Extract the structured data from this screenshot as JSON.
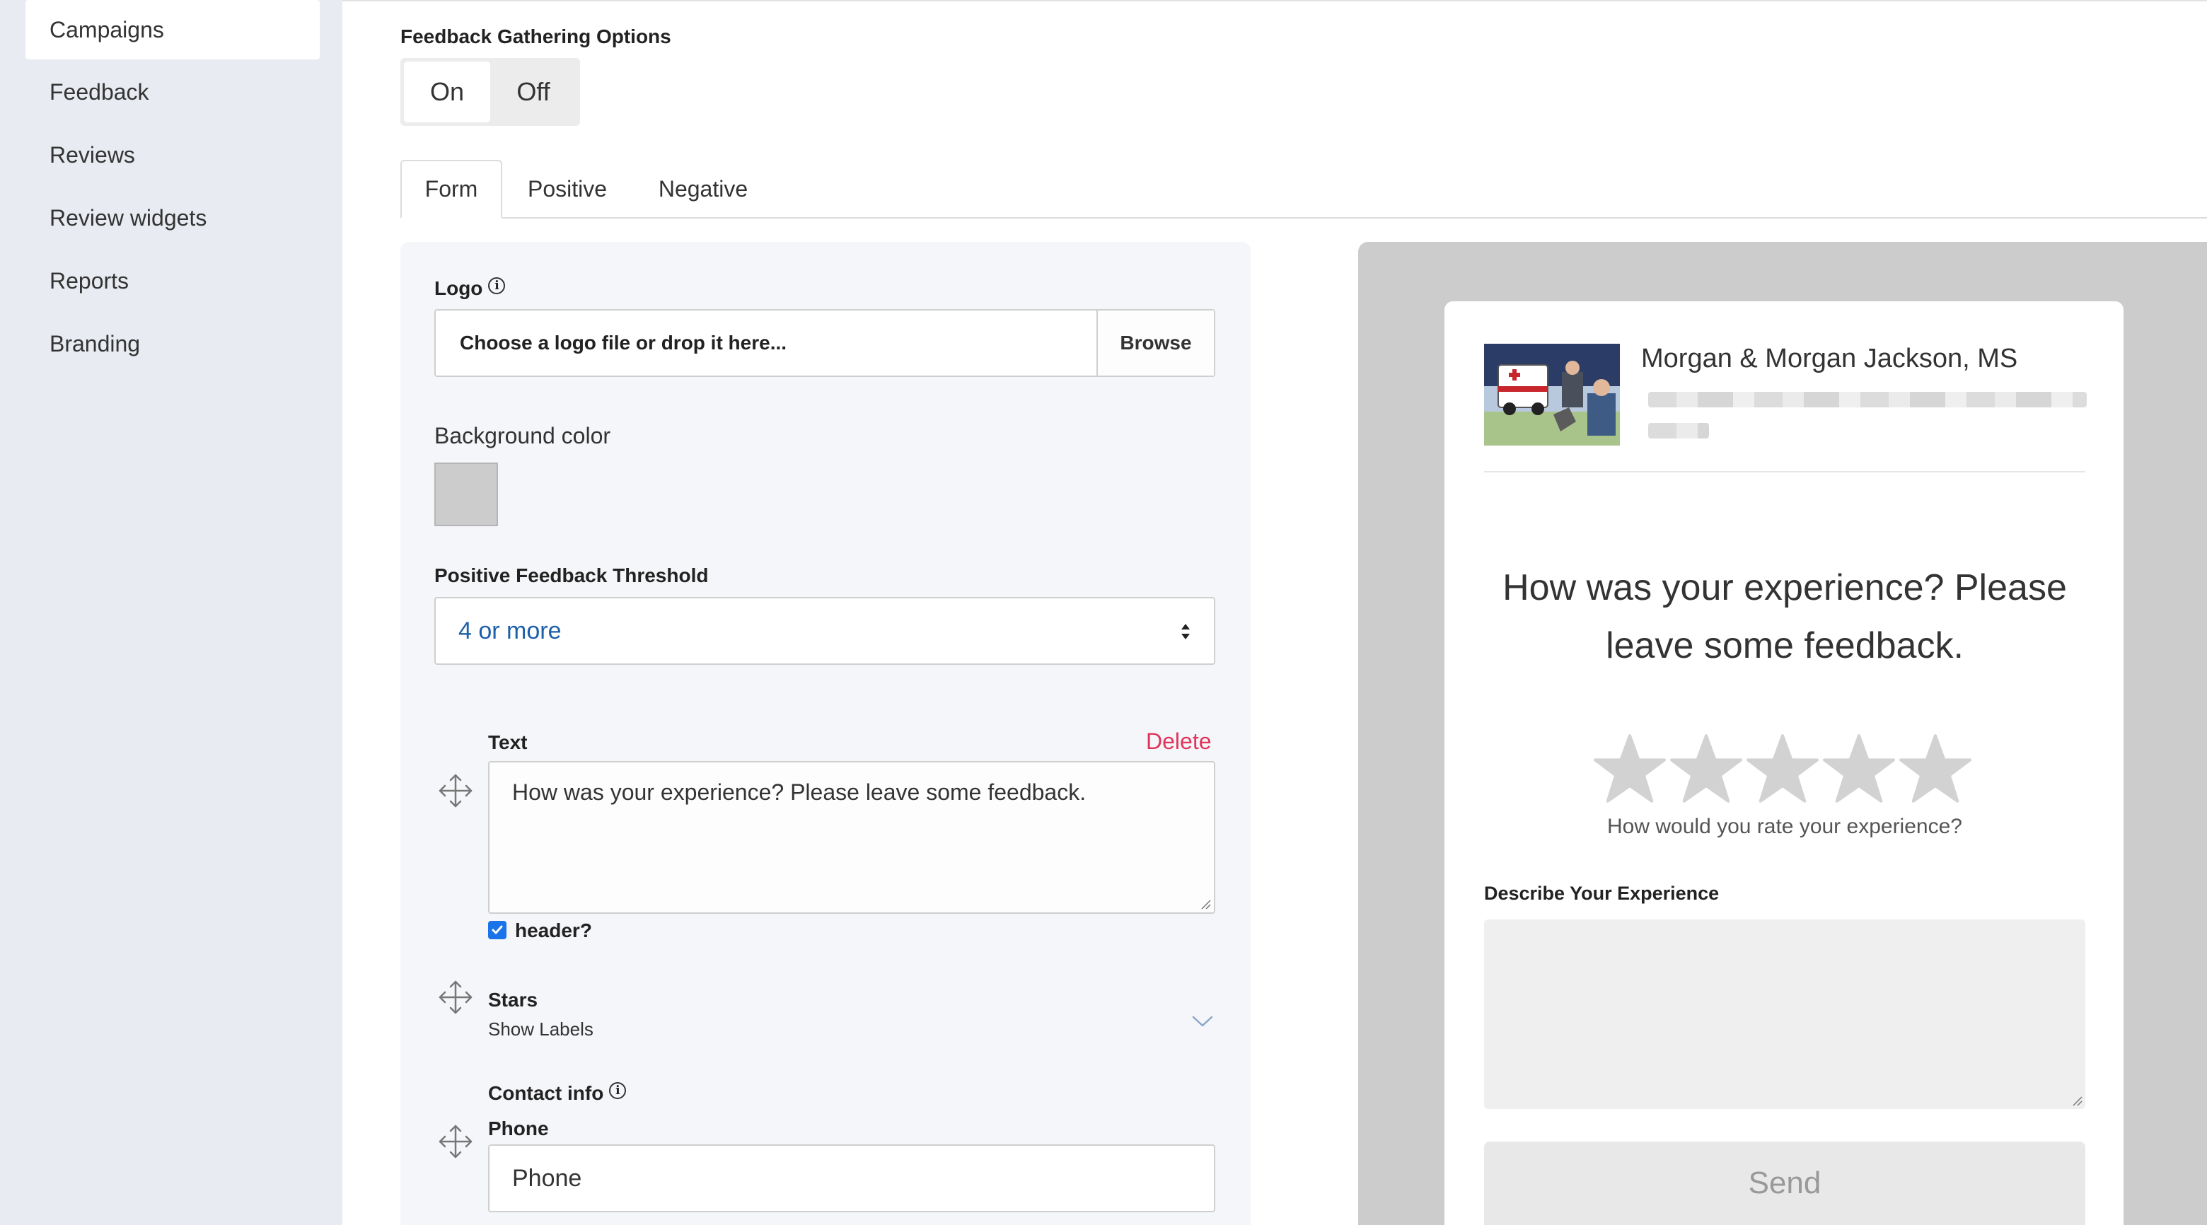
{
  "sidebar": {
    "items": [
      {
        "label": "Campaigns",
        "active": true
      },
      {
        "label": "Feedback",
        "active": false
      },
      {
        "label": "Reviews",
        "active": false
      },
      {
        "label": "Review widgets",
        "active": false
      },
      {
        "label": "Reports",
        "active": false
      },
      {
        "label": "Branding",
        "active": false
      }
    ]
  },
  "feedback_options": {
    "label": "Feedback Gathering Options",
    "on_label": "On",
    "off_label": "Off",
    "selected": "On"
  },
  "tabs": [
    {
      "label": "Form",
      "active": true
    },
    {
      "label": "Positive",
      "active": false
    },
    {
      "label": "Negative",
      "active": false
    }
  ],
  "form": {
    "logo_label": "Logo",
    "logo_placeholder": "Choose a logo file or drop it here...",
    "browse_label": "Browse",
    "background_color_label": "Background color",
    "background_color": "#cccccc",
    "threshold_label": "Positive Feedback Threshold",
    "threshold_value": "4 or more",
    "text_block": {
      "label": "Text",
      "delete_label": "Delete",
      "value": "How was your experience? Please leave some feedback.",
      "header_checkbox_label": "header?",
      "header_checked": true
    },
    "stars_block": {
      "label": "Stars",
      "sub_label": "Show Labels"
    },
    "contact_block": {
      "label": "Contact info",
      "phone_label": "Phone",
      "phone_placeholder": "Phone"
    }
  },
  "preview": {
    "business_name": "Morgan & Morgan Jackson, MS",
    "question": "How was your experience? Please leave some feedback.",
    "rating_label": "How would you rate your experience?",
    "star_count": 5,
    "describe_label": "Describe Your Experience",
    "send_label": "Send"
  },
  "colors": {
    "sidebar_bg": "#e8ebf1",
    "accent_blue": "#1a73e8",
    "select_text": "#1d5fa8",
    "delete_red": "#e0355c",
    "preview_bg": "#cccccc",
    "star_gray": "#d2d2d2"
  },
  "icons": [
    "info-icon",
    "move-icon",
    "chevron-down-icon",
    "select-arrows-icon",
    "star-icon",
    "check-icon",
    "resize-grip-icon"
  ]
}
